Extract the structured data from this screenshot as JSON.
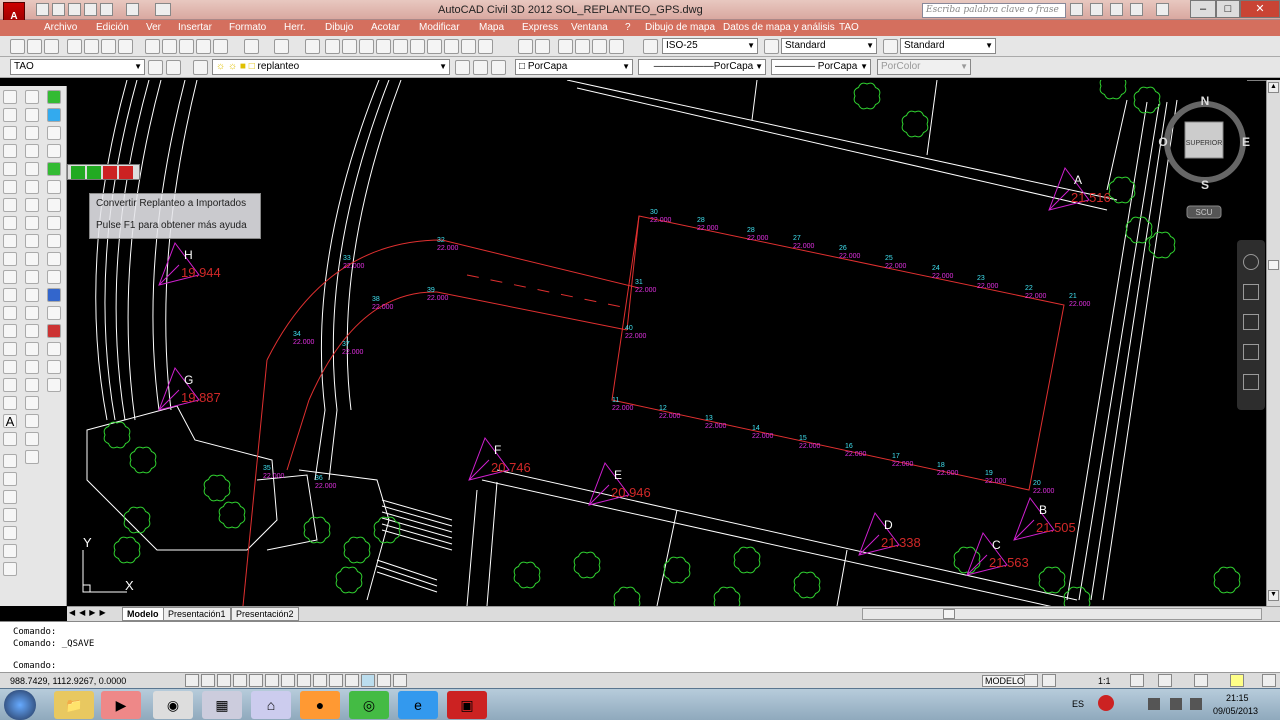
{
  "window": {
    "title": "AutoCAD Civil 3D 2012    SOL_REPLANTEO_GPS.dwg",
    "search_placeholder": "Escriba palabra clave o frase"
  },
  "menu": [
    "Archivo",
    "Edición",
    "Ver",
    "Insertar",
    "Formato",
    "Herr.",
    "Dibujo",
    "Acotar",
    "Modificar",
    "Mapa",
    "Express",
    "Ventana",
    "?",
    "Dibujo de mapa",
    "Datos de mapa y análisis",
    "TAO"
  ],
  "toolbar": {
    "dim_style": "ISO-25",
    "text_style": "Standard",
    "table_style": "Standard",
    "workspace": "TAO",
    "layer": "replanteo",
    "color": "PorCapa",
    "linetype": "PorCapa",
    "lineweight": "PorCapa",
    "plotstyle": "PorColor"
  },
  "tooltip": {
    "line1": "Convertir Replanteo a Importados",
    "line2": "Pulse F1 para obtener más ayuda"
  },
  "viewcube": {
    "face": "SUPERIOR",
    "north": "N",
    "south": "S",
    "east": "E",
    "west": "O",
    "ucs": "SCU"
  },
  "stations": [
    {
      "id": "A",
      "elev": "21.516"
    },
    {
      "id": "B",
      "elev": "21.505"
    },
    {
      "id": "C",
      "elev": "21.563"
    },
    {
      "id": "D",
      "elev": "21.338"
    },
    {
      "id": "E",
      "elev": "20.946"
    },
    {
      "id": "F",
      "elev": "20.746"
    },
    {
      "id": "G",
      "elev": "19.887"
    },
    {
      "id": "H",
      "elev": "19.944"
    }
  ],
  "points": [
    {
      "n": "11",
      "z": "22.000"
    },
    {
      "n": "12",
      "z": "22.000"
    },
    {
      "n": "13",
      "z": "22.000"
    },
    {
      "n": "14",
      "z": "22.000"
    },
    {
      "n": "15",
      "z": "22.000"
    },
    {
      "n": "16",
      "z": "22.000"
    },
    {
      "n": "17",
      "z": "22.000"
    },
    {
      "n": "18",
      "z": "22.000"
    },
    {
      "n": "19",
      "z": "22.000"
    },
    {
      "n": "20",
      "z": "22.000"
    },
    {
      "n": "21",
      "z": "22.000"
    },
    {
      "n": "22",
      "z": "22.000"
    },
    {
      "n": "23",
      "z": "22.000"
    },
    {
      "n": "24",
      "z": "22.000"
    },
    {
      "n": "25",
      "z": "22.000"
    },
    {
      "n": "26",
      "z": "22.000"
    },
    {
      "n": "27",
      "z": "22.000"
    },
    {
      "n": "28",
      "z": "22.000"
    },
    {
      "n": "28",
      "z": "22.000"
    },
    {
      "n": "30",
      "z": "22.000"
    },
    {
      "n": "31",
      "z": "22.000"
    },
    {
      "n": "32",
      "z": "22.000"
    },
    {
      "n": "33",
      "z": "22.000"
    },
    {
      "n": "34",
      "z": "22.000"
    },
    {
      "n": "35",
      "z": "22.000"
    },
    {
      "n": "36",
      "z": "22.000"
    },
    {
      "n": "37",
      "z": "22.000"
    },
    {
      "n": "38",
      "z": "22.000"
    },
    {
      "n": "39",
      "z": "22.000"
    },
    {
      "n": "40",
      "z": "22.000"
    }
  ],
  "ucs_axes": {
    "x": "X",
    "y": "Y"
  },
  "tabs": [
    "Modelo",
    "Presentación1",
    "Presentación2"
  ],
  "command": {
    "line1": "Comando:",
    "line2": "Comando:  _QSAVE",
    "prompt": "Comando:"
  },
  "status": {
    "coords": "988.7429,  1112.9267, 0.0000",
    "mode": "MODELO",
    "scale": "1:1"
  },
  "taskbar": {
    "lang": "ES",
    "time": "21:15",
    "date": "09/05/2013"
  },
  "colors": {
    "menubar": "#d46f5e",
    "station": "#d020d0",
    "label_red": "#d02828",
    "point_label": "#e030e0",
    "cyan_text": "#40e0f0",
    "tree": "#30d030"
  }
}
